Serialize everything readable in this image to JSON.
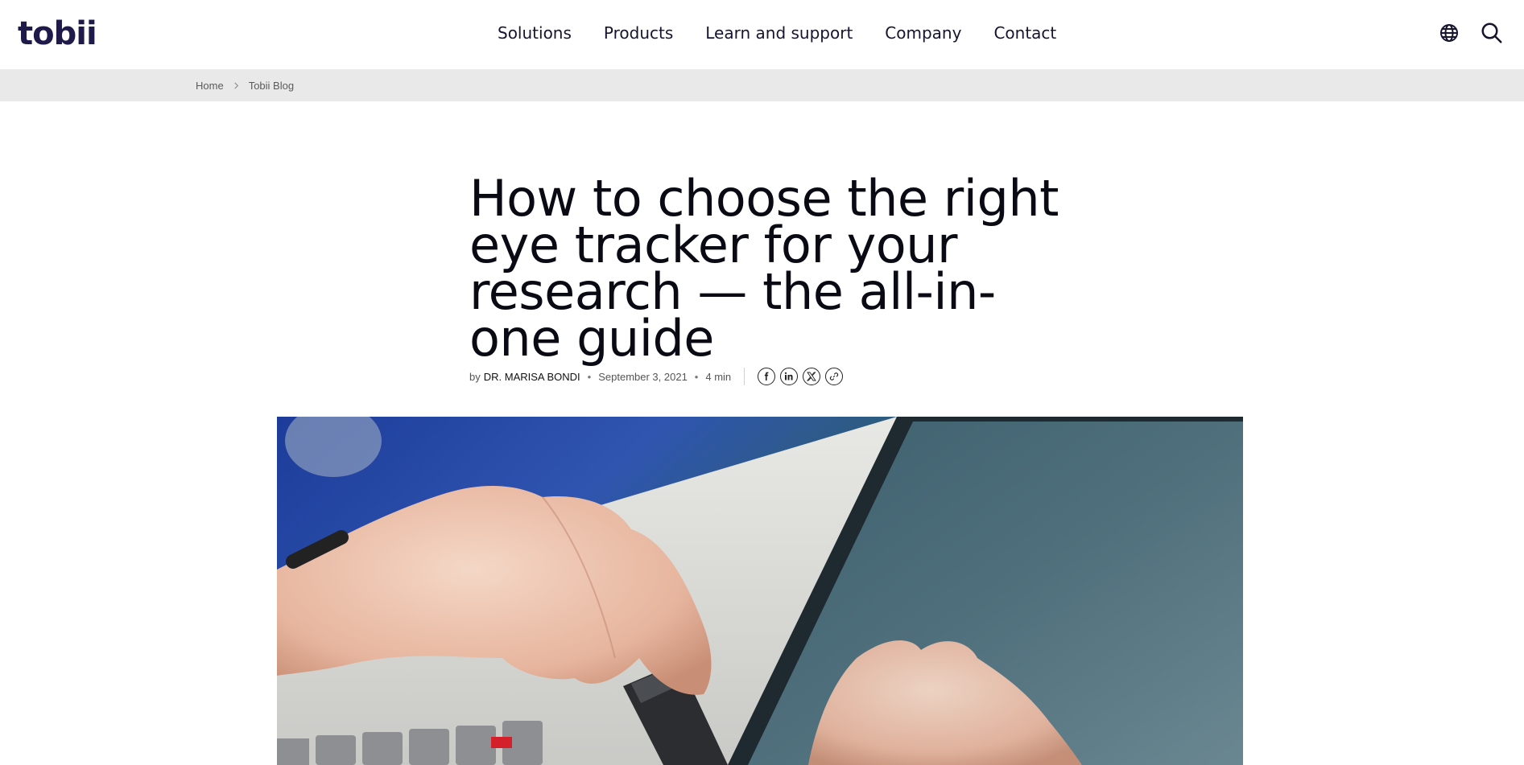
{
  "header": {
    "logo_text": "tobii",
    "nav": [
      {
        "label": "Solutions"
      },
      {
        "label": "Products"
      },
      {
        "label": "Learn and support"
      },
      {
        "label": "Company"
      },
      {
        "label": "Contact"
      }
    ],
    "icons": [
      "globe-icon",
      "search-icon"
    ]
  },
  "breadcrumb": {
    "items": [
      {
        "label": "Home"
      },
      {
        "label": "Tobii Blog"
      }
    ],
    "separator_icon": "chevron-right-icon"
  },
  "article": {
    "title": "How to choose the right eye tracker for your research — the all-in-one guide",
    "by": "by",
    "author": "DR. MARISA BONDI",
    "date": "September 3, 2021",
    "read_time": "4 min",
    "share_icons": [
      "facebook-icon",
      "linkedin-icon",
      "x-icon",
      "link-icon"
    ],
    "hero_image": "hands-plugging-eye-tracker-into-laptop"
  },
  "colors": {
    "brand": "#1e1b4b",
    "breadcrumb_bg": "#e9e9e9",
    "text": "#0a0a14"
  }
}
